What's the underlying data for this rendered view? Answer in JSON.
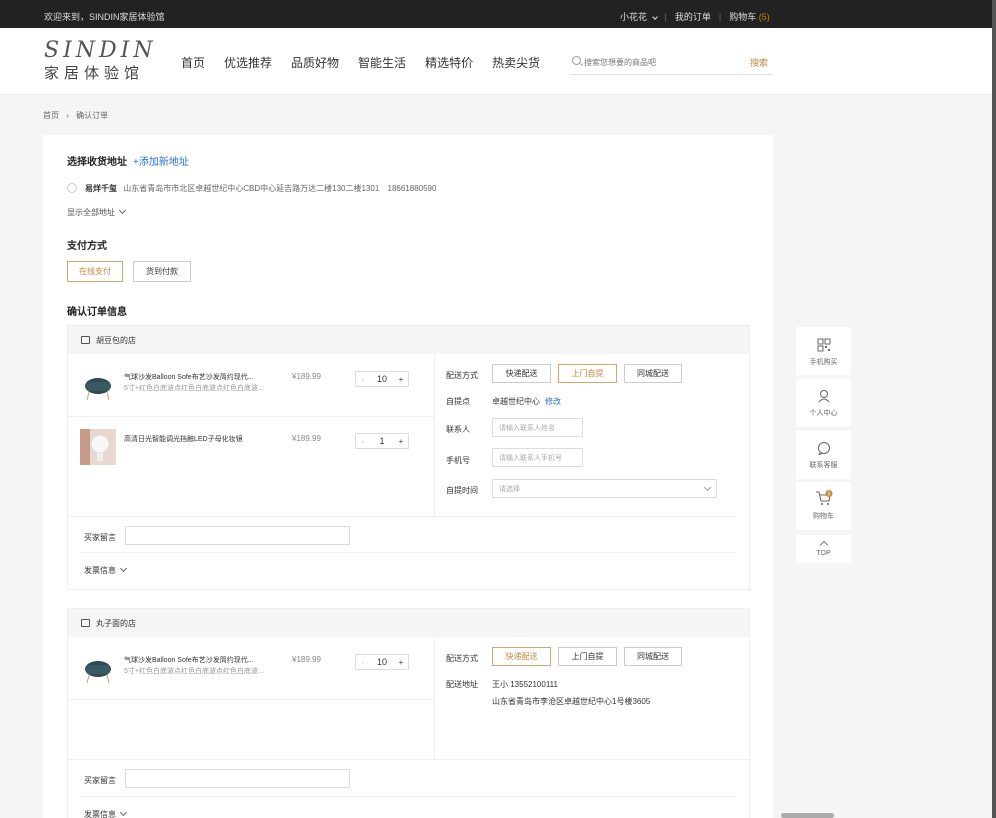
{
  "topbar": {
    "welcome": "欢迎来到，SINDIN家居体验馆",
    "user": "小花花",
    "orders": "我的订单",
    "cart": "购物车",
    "cart_count": "(5)"
  },
  "logo": {
    "en": "SINDIN",
    "cn": "家居体验馆"
  },
  "nav": [
    "首页",
    "优选推荐",
    "品质好物",
    "智能生活",
    "精选特价",
    "热卖尖货"
  ],
  "search": {
    "placeholder": "搜索您想要的商品吧",
    "button": "搜索"
  },
  "breadcrumb": {
    "home": "首页",
    "current": "确认订单"
  },
  "address": {
    "title": "选择收货地址",
    "add": "+添加新地址",
    "name": "易烊千玺",
    "detail": "山东省青岛市市北区卓越世纪中心CBD中心延吉路万达二楼130二楼1301",
    "phone": "18661880590",
    "show_all": "显示全部地址"
  },
  "payment": {
    "title": "支付方式",
    "online": "在线支付",
    "cod": "货到付款"
  },
  "confirm_title": "确认订单信息",
  "shops": [
    {
      "name": "胡豆包的店",
      "products": [
        {
          "name": "气球沙发Balloon Sofe布艺沙发简约现代...",
          "sub": "5寸+红色白底波点红色白底波点红色白底波...",
          "price": "¥189.99",
          "qty": "10"
        },
        {
          "name": "高清日光智能调光挡触LED子母化妆镜",
          "sub": "",
          "price": "¥189.99",
          "qty": "1"
        }
      ],
      "delivery": {
        "label": "配送方式",
        "options": [
          "快递配送",
          "上门自提",
          "同城配送"
        ],
        "pickup_label": "自提点",
        "pickup_value": "卓越世纪中心",
        "modify": "修改",
        "contact_label": "联系人",
        "contact_placeholder": "请输入联系人姓名",
        "phone_label": "手机号",
        "phone_placeholder": "请输入联系人手机号",
        "time_label": "自提时间",
        "time_placeholder": "请选择"
      },
      "message_label": "买家留言",
      "invoice_label": "发票信息"
    },
    {
      "name": "丸子面的店",
      "products": [
        {
          "name": "气球沙发Balloon Sofe布艺沙发简约现代...",
          "sub": "5寸+红色白底波点红色白底波点红色白底波...",
          "price": "¥189.99",
          "qty": "10"
        }
      ],
      "delivery": {
        "label": "配送方式",
        "options": [
          "快递配送",
          "上门自提",
          "同城配送"
        ],
        "addr_label": "配送地址",
        "addr_name": "王小 13552100111",
        "addr_detail": "山东省青岛市李沧区卓越世纪中心1号楼3605"
      },
      "message_label": "买家留言",
      "invoice_label": "发票信息"
    }
  ],
  "sidebar": {
    "mobile": "手机购买",
    "personal": "个人中心",
    "service": "联系客服",
    "cart": "购物车",
    "cart_badge": "5",
    "top": "TOP"
  },
  "colors": {
    "accent": "#c8873b",
    "link": "#2a6fd6",
    "topbar": "#222222"
  }
}
